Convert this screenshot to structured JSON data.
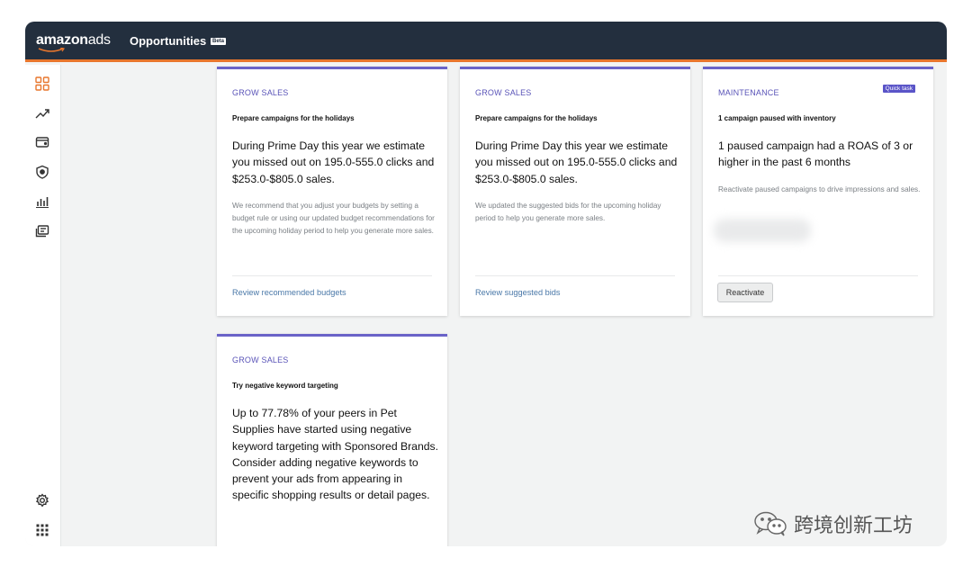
{
  "header": {
    "logo_brand": "amazon",
    "logo_product": "ads",
    "title": "Opportunities",
    "badge": "Beta"
  },
  "sidebar": {
    "icons": [
      "grid-icon",
      "trend-up-icon",
      "wallet-icon",
      "shield-icon",
      "bar-chart-icon",
      "ad-media-icon"
    ],
    "bottom_icons": [
      "settings-icon",
      "apps-grid-icon"
    ]
  },
  "cards": [
    {
      "tag": "GROW SALES",
      "heading": "Prepare campaigns for the holidays",
      "body": "During Prime Day this year we estimate you missed out on 195.0-555.0 clicks and $253.0-$805.0 sales.",
      "desc": "We recommend that you adjust your budgets by setting a budget rule or using our updated budget recommendations for the upcoming holiday period to help you generate more sales.",
      "link": "Review recommended budgets"
    },
    {
      "tag": "GROW SALES",
      "heading": "Prepare campaigns for the holidays",
      "body": "During Prime Day this year we estimate you missed out on 195.0-555.0 clicks and $253.0-$805.0 sales.",
      "desc": "We updated the suggested bids for the upcoming holiday period to help you generate more sales.",
      "link": "Review suggested bids"
    },
    {
      "tag": "MAINTENANCE",
      "badge": "Quick task",
      "heading": "1 campaign paused with inventory",
      "body": "1 paused campaign had a ROAS of 3 or higher in the past 6 months",
      "desc": "Reactivate paused campaigns to drive impressions and sales.",
      "button": "Reactivate"
    },
    {
      "tag": "GROW SALES",
      "heading": "Try negative keyword targeting",
      "body": "Up to 77.78% of your peers in Pet Supplies have started using negative keyword targeting with Sponsored Brands. Consider adding negative keywords to prevent your ads from appearing in specific shopping results or detail pages."
    }
  ],
  "watermark": {
    "text": "跨境创新工坊"
  },
  "colors": {
    "topbar": "#232f3e",
    "accent_orange": "#e8762d",
    "card_accent": "#6a63c8",
    "link": "#4a78a8"
  }
}
